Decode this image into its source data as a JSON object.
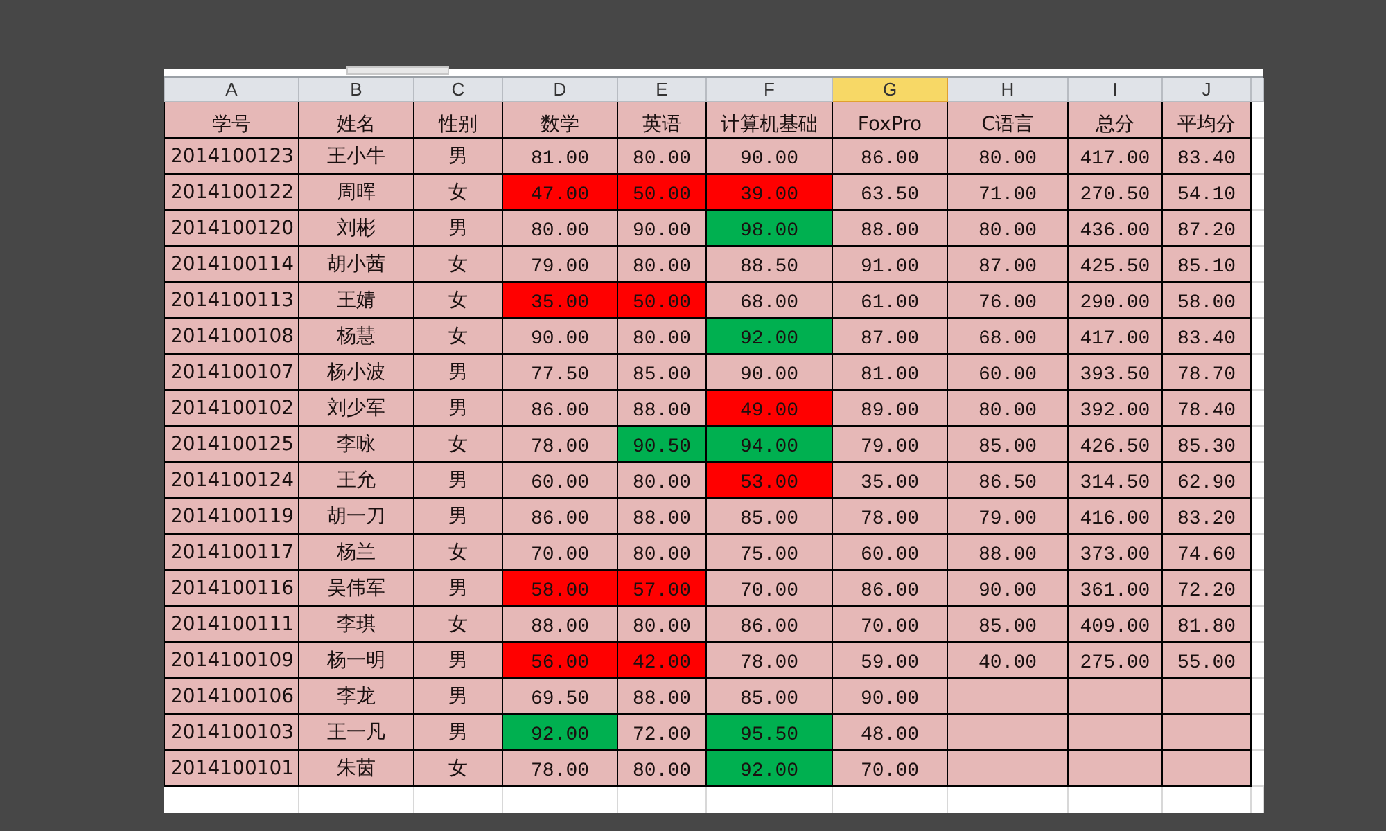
{
  "columns": [
    {
      "label": "A",
      "selected": false
    },
    {
      "label": "B",
      "selected": false
    },
    {
      "label": "C",
      "selected": false
    },
    {
      "label": "D",
      "selected": false
    },
    {
      "label": "E",
      "selected": false
    },
    {
      "label": "F",
      "selected": false
    },
    {
      "label": "G",
      "selected": true
    },
    {
      "label": "H",
      "selected": false
    },
    {
      "label": "I",
      "selected": false
    },
    {
      "label": "J",
      "selected": false
    }
  ],
  "header": [
    "学号",
    "姓名",
    "性别",
    "数学",
    "英语",
    "计算机基础",
    "FoxPro",
    "C语言",
    "总分",
    "平均分"
  ],
  "rows": [
    {
      "cells": [
        {
          "text": "2014100123"
        },
        {
          "text": "王小牛"
        },
        {
          "text": "男"
        },
        {
          "text": "81.00"
        },
        {
          "text": "80.00"
        },
        {
          "text": "90.00"
        },
        {
          "text": "86.00"
        },
        {
          "text": "80.00"
        },
        {
          "text": "417.00"
        },
        {
          "text": "83.40"
        }
      ]
    },
    {
      "cells": [
        {
          "text": "2014100122"
        },
        {
          "text": "周晖"
        },
        {
          "text": "女"
        },
        {
          "text": "47.00",
          "color": "#ff0000"
        },
        {
          "text": "50.00",
          "color": "#ff0000"
        },
        {
          "text": "39.00",
          "color": "#ff0000"
        },
        {
          "text": "63.50"
        },
        {
          "text": "71.00"
        },
        {
          "text": "270.50"
        },
        {
          "text": "54.10"
        }
      ]
    },
    {
      "cells": [
        {
          "text": "2014100120"
        },
        {
          "text": "刘彬"
        },
        {
          "text": "男"
        },
        {
          "text": "80.00"
        },
        {
          "text": "90.00"
        },
        {
          "text": "98.00",
          "color": "#00b050"
        },
        {
          "text": "88.00"
        },
        {
          "text": "80.00"
        },
        {
          "text": "436.00"
        },
        {
          "text": "87.20"
        }
      ]
    },
    {
      "cells": [
        {
          "text": "2014100114"
        },
        {
          "text": "胡小茜"
        },
        {
          "text": "女"
        },
        {
          "text": "79.00"
        },
        {
          "text": "80.00"
        },
        {
          "text": "88.50"
        },
        {
          "text": "91.00"
        },
        {
          "text": "87.00"
        },
        {
          "text": "425.50"
        },
        {
          "text": "85.10"
        }
      ]
    },
    {
      "cells": [
        {
          "text": "2014100113"
        },
        {
          "text": "王婧"
        },
        {
          "text": "女"
        },
        {
          "text": "35.00",
          "color": "#ff0000"
        },
        {
          "text": "50.00",
          "color": "#ff0000"
        },
        {
          "text": "68.00"
        },
        {
          "text": "61.00"
        },
        {
          "text": "76.00"
        },
        {
          "text": "290.00"
        },
        {
          "text": "58.00"
        }
      ]
    },
    {
      "cells": [
        {
          "text": "2014100108"
        },
        {
          "text": "杨慧"
        },
        {
          "text": "女"
        },
        {
          "text": "90.00"
        },
        {
          "text": "80.00"
        },
        {
          "text": "92.00",
          "color": "#00b050"
        },
        {
          "text": "87.00"
        },
        {
          "text": "68.00"
        },
        {
          "text": "417.00"
        },
        {
          "text": "83.40"
        }
      ]
    },
    {
      "cells": [
        {
          "text": "2014100107"
        },
        {
          "text": "杨小波"
        },
        {
          "text": "男"
        },
        {
          "text": "77.50"
        },
        {
          "text": "85.00"
        },
        {
          "text": "90.00"
        },
        {
          "text": "81.00"
        },
        {
          "text": "60.00"
        },
        {
          "text": "393.50"
        },
        {
          "text": "78.70"
        }
      ]
    },
    {
      "cells": [
        {
          "text": "2014100102"
        },
        {
          "text": "刘少军"
        },
        {
          "text": "男"
        },
        {
          "text": "86.00"
        },
        {
          "text": "88.00"
        },
        {
          "text": "49.00",
          "color": "#ff0000"
        },
        {
          "text": "89.00"
        },
        {
          "text": "80.00"
        },
        {
          "text": "392.00"
        },
        {
          "text": "78.40"
        }
      ]
    },
    {
      "cells": [
        {
          "text": "2014100125"
        },
        {
          "text": "李咏"
        },
        {
          "text": "女"
        },
        {
          "text": "78.00"
        },
        {
          "text": "90.50",
          "color": "#00b050"
        },
        {
          "text": "94.00",
          "color": "#00b050"
        },
        {
          "text": "79.00"
        },
        {
          "text": "85.00"
        },
        {
          "text": "426.50"
        },
        {
          "text": "85.30"
        }
      ]
    },
    {
      "cells": [
        {
          "text": "2014100124"
        },
        {
          "text": "王允"
        },
        {
          "text": "男"
        },
        {
          "text": "60.00"
        },
        {
          "text": "80.00"
        },
        {
          "text": "53.00",
          "color": "#ff0000"
        },
        {
          "text": "35.00"
        },
        {
          "text": "86.50"
        },
        {
          "text": "314.50"
        },
        {
          "text": "62.90"
        }
      ]
    },
    {
      "cells": [
        {
          "text": "2014100119"
        },
        {
          "text": "胡一刀"
        },
        {
          "text": "男"
        },
        {
          "text": "86.00"
        },
        {
          "text": "88.00"
        },
        {
          "text": "85.00"
        },
        {
          "text": "78.00"
        },
        {
          "text": "79.00"
        },
        {
          "text": "416.00"
        },
        {
          "text": "83.20"
        }
      ]
    },
    {
      "cells": [
        {
          "text": "2014100117"
        },
        {
          "text": "杨兰"
        },
        {
          "text": "女"
        },
        {
          "text": "70.00"
        },
        {
          "text": "80.00"
        },
        {
          "text": "75.00"
        },
        {
          "text": "60.00"
        },
        {
          "text": "88.00"
        },
        {
          "text": "373.00"
        },
        {
          "text": "74.60"
        }
      ]
    },
    {
      "cells": [
        {
          "text": "2014100116"
        },
        {
          "text": "吴伟军"
        },
        {
          "text": "男"
        },
        {
          "text": "58.00",
          "color": "#ff0000"
        },
        {
          "text": "57.00",
          "color": "#ff0000"
        },
        {
          "text": "70.00"
        },
        {
          "text": "86.00"
        },
        {
          "text": "90.00"
        },
        {
          "text": "361.00"
        },
        {
          "text": "72.20"
        }
      ]
    },
    {
      "cells": [
        {
          "text": "2014100111"
        },
        {
          "text": "李琪"
        },
        {
          "text": "女"
        },
        {
          "text": "88.00"
        },
        {
          "text": "80.00"
        },
        {
          "text": "86.00"
        },
        {
          "text": "70.00"
        },
        {
          "text": "85.00"
        },
        {
          "text": "409.00"
        },
        {
          "text": "81.80"
        }
      ]
    },
    {
      "cells": [
        {
          "text": "2014100109"
        },
        {
          "text": "杨一明"
        },
        {
          "text": "男"
        },
        {
          "text": "56.00",
          "color": "#ff0000"
        },
        {
          "text": "42.00",
          "color": "#ff0000"
        },
        {
          "text": "78.00"
        },
        {
          "text": "59.00"
        },
        {
          "text": "40.00"
        },
        {
          "text": "275.00"
        },
        {
          "text": "55.00"
        }
      ]
    },
    {
      "cells": [
        {
          "text": "2014100106"
        },
        {
          "text": "李龙"
        },
        {
          "text": "男"
        },
        {
          "text": "69.50"
        },
        {
          "text": "88.00"
        },
        {
          "text": "85.00"
        },
        {
          "text": "90.00"
        }
      ]
    },
    {
      "cells": [
        {
          "text": "2014100103"
        },
        {
          "text": "王一凡"
        },
        {
          "text": "男"
        },
        {
          "text": "92.00",
          "color": "#00b050"
        },
        {
          "text": "72.00"
        },
        {
          "text": "95.50",
          "color": "#00b050"
        },
        {
          "text": "48.00"
        }
      ]
    },
    {
      "cells": [
        {
          "text": "2014100101"
        },
        {
          "text": "朱茵"
        },
        {
          "text": "女"
        },
        {
          "text": "78.00"
        },
        {
          "text": "80.00"
        },
        {
          "text": "92.00",
          "color": "#00b050"
        },
        {
          "text": "70.00"
        }
      ]
    }
  ]
}
